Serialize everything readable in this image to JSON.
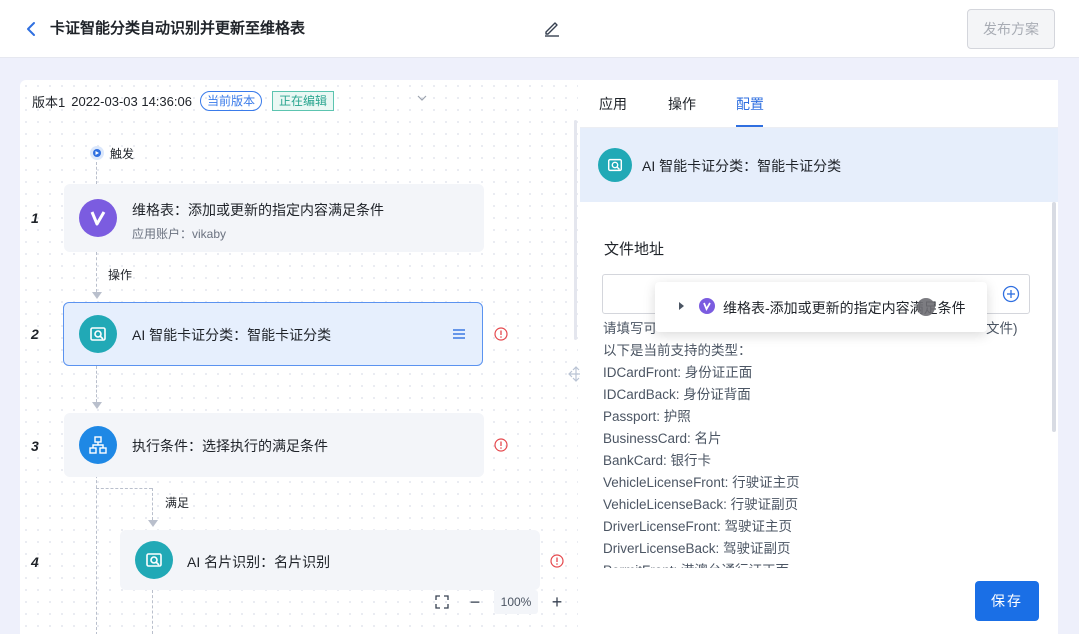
{
  "header": {
    "title": "卡证智能分类自动识别并更新至维格表",
    "publish_label": "发布方案"
  },
  "version": {
    "name": "版本1",
    "datetime": "2022-03-03 14:36:06",
    "current_badge": "当前版本",
    "editing_badge": "正在编辑"
  },
  "flow": {
    "trigger_label": "触发",
    "edge_action_label": "操作",
    "edge_condition_label": "满足",
    "nodes": [
      {
        "num": "1",
        "title": "维格表：添加或更新的指定内容满足条件",
        "subtitle": "应用账户：vikaby",
        "icon": "vika-logo-icon"
      },
      {
        "num": "2",
        "title": "AI 智能卡证分类：智能卡证分类",
        "icon": "card-scan-icon"
      },
      {
        "num": "3",
        "title": "执行条件：选择执行的满足条件",
        "icon": "branch-icon"
      },
      {
        "num": "4",
        "title": "AI 名片识别：名片识别",
        "icon": "card-scan-icon"
      }
    ],
    "zoom": {
      "value": "100%",
      "minus": "−",
      "plus": "+"
    }
  },
  "panel": {
    "tabs": [
      "应用",
      "操作",
      "配置"
    ],
    "active_tab": "配置",
    "head_title": "AI 智能卡证分类：智能卡证分类",
    "field_label": "文件地址",
    "dropdown_item": "维格表-添加或更新的指定内容满足条件",
    "help_lines": [
      "请填写可",
      "以下是当前支持的类型：",
      "IDCardFront: 身份证正面",
      "IDCardBack: 身份证背面",
      "Passport: 护照",
      "BusinessCard: 名片",
      "BankCard: 银行卡",
      "VehicleLicenseFront: 行驶证主页",
      "VehicleLicenseBack: 行驶证副页",
      "DriverLicenseFront: 驾驶证主页",
      "DriverLicenseBack: 驾驶证副页",
      "PermitFront: 港澳台通行证正面"
    ],
    "help_suffix": "文件)",
    "save_label": "保存"
  },
  "colors": {
    "primary": "#1a6fe6",
    "node_teal": "#21a9b6",
    "node_purple": "#7b5ce0",
    "node_blue": "#1e88e5",
    "warning": "#e5484d"
  }
}
